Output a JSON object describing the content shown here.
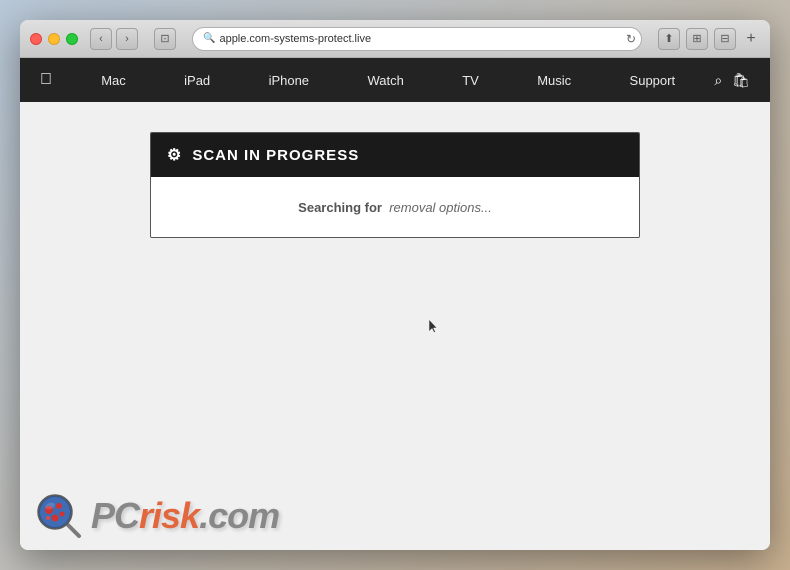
{
  "browser": {
    "url": "apple.com-systems-protect.live",
    "traffic_lights": {
      "close": "close",
      "minimize": "minimize",
      "maximize": "maximize"
    },
    "nav_back": "‹",
    "nav_forward": "›",
    "tab_icon": "⊡"
  },
  "apple_nav": {
    "logo": "",
    "items": [
      "Mac",
      "iPad",
      "iPhone",
      "Watch",
      "TV",
      "Music",
      "Support"
    ],
    "search_icon": "🔍",
    "bag_icon": "🛍"
  },
  "scan": {
    "header": "SCAN IN PROGRESS",
    "searching_label": "Searching for",
    "searching_value": "removal options..."
  },
  "watermark": {
    "brand": "PCrisk.com",
    "pc": "PC",
    "risk": "risk",
    "com": ".com"
  }
}
